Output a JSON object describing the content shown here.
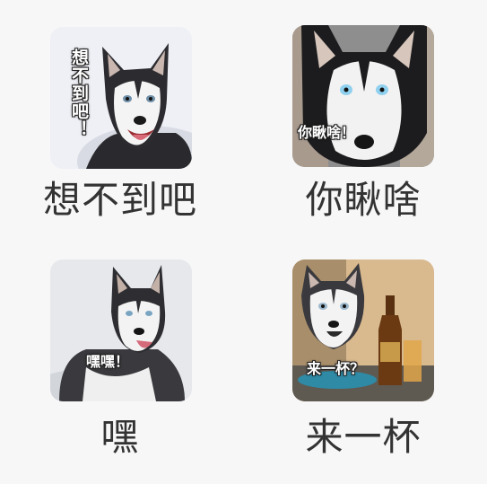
{
  "stickers": [
    {
      "label": "想不到吧",
      "caption": "想不到吧！",
      "bg": "#eef0f6",
      "icon": "husky-sticker-icon"
    },
    {
      "label": "你瞅啥",
      "caption": "你瞅啥！",
      "bg": "#8e8e8e",
      "icon": "husky-sticker-icon"
    },
    {
      "label": "嘿",
      "caption": "嘿嘿！",
      "bg": "#e6e8ec",
      "icon": "husky-sticker-icon"
    },
    {
      "label": "来一杯",
      "caption": "来一杯？",
      "bg": "#d9b98e",
      "icon": "husky-beer-sticker-icon"
    }
  ]
}
